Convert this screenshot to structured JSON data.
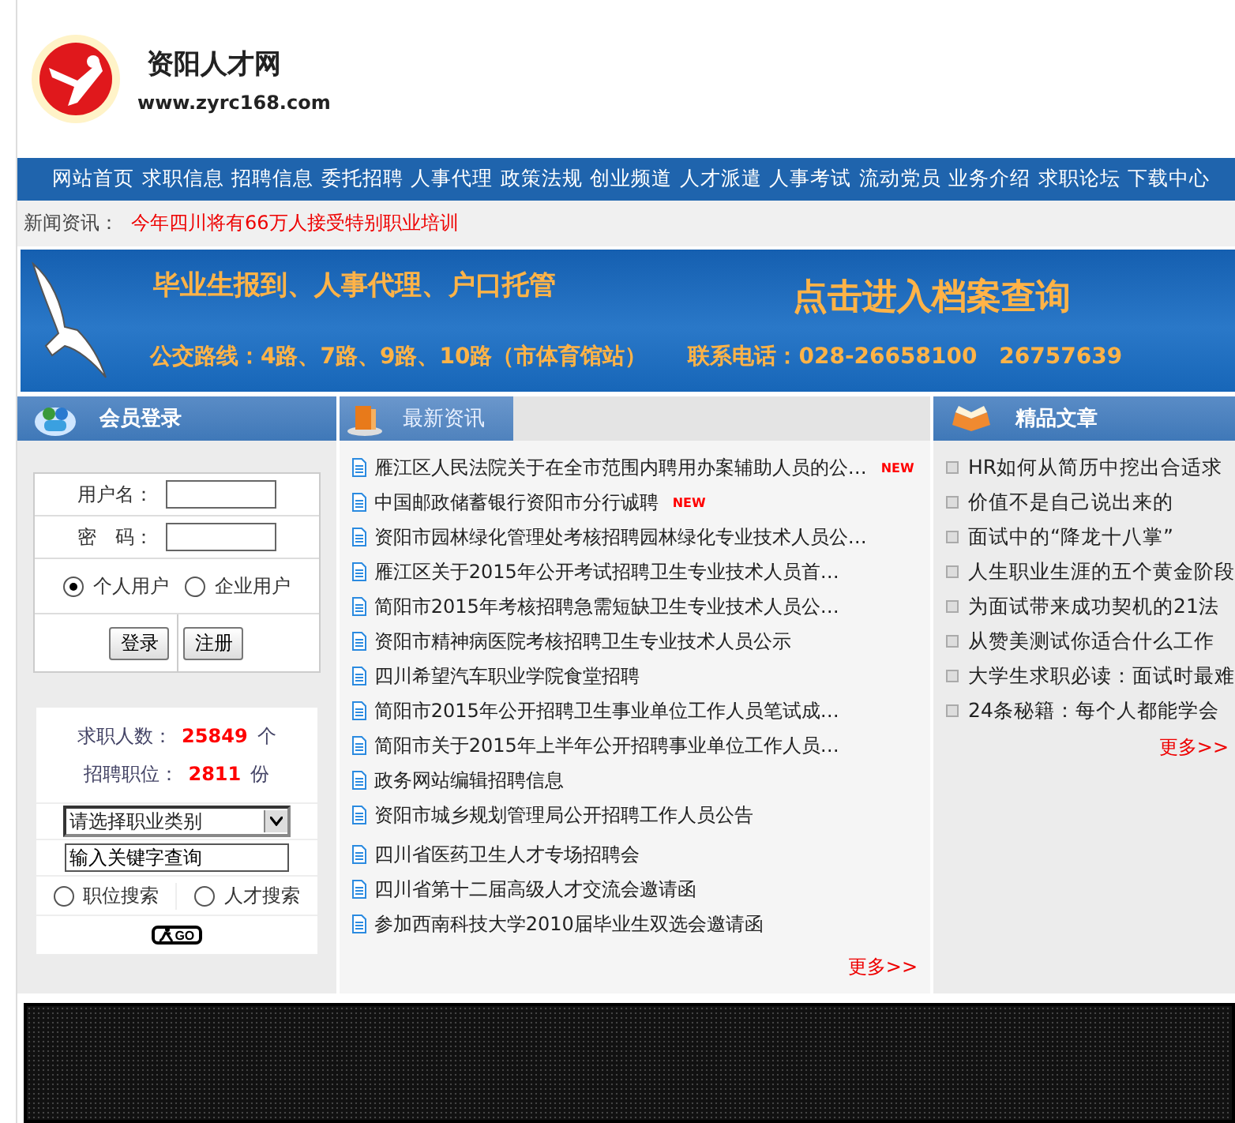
{
  "header": {
    "site_name": "资阳人才网",
    "url": "www.zyrc168.com"
  },
  "nav": [
    "网站首页",
    "求职信息",
    "招聘信息",
    "委托招聘",
    "人事代理",
    "政策法规",
    "创业频道",
    "人才派遣",
    "人事考试",
    "流动党员",
    "业务介绍",
    "求职论坛",
    "下载中心"
  ],
  "ticker": {
    "label": "新闻资讯：",
    "headline": "今年四川将有66万人接受特别职业培训"
  },
  "banner": {
    "headline": "毕业生报到、人事代理、户口托管",
    "link": "点击进入档案查询",
    "bus": "公交路线：4路、7路、9路、10路（市体育馆站）",
    "phone": "联系电话：028-26658100　26757639"
  },
  "login": {
    "title": "会员登录",
    "username_label": "用户名：",
    "password_label": "密　码：",
    "user_types": [
      {
        "label": "个人用户",
        "selected": true
      },
      {
        "label": "企业用户",
        "selected": false
      }
    ],
    "buttons": [
      "登录",
      "注册"
    ]
  },
  "stats": [
    {
      "label": "求职人数：",
      "value": "25849",
      "unit": "个"
    },
    {
      "label": "招聘职位：",
      "value": "2811",
      "unit": "份"
    }
  ],
  "search": {
    "category": "请选择职业类别",
    "keyword": "输入关键字查询",
    "modes": [
      {
        "label": "职位搜索",
        "selected": false
      },
      {
        "label": "人才搜索",
        "selected": false
      }
    ],
    "go": "GO"
  },
  "news": {
    "title": "最新资讯",
    "items": [
      {
        "text": "雁江区人民法院关于在全市范围内聘用办案辅助人员的公…",
        "badge": "NEW"
      },
      {
        "text": "中国邮政储蓄银行资阳市分行诚聘",
        "badge": "NEW"
      },
      {
        "text": "资阳市园林绿化管理处考核招聘园林绿化专业技术人员公…"
      },
      {
        "text": "雁江区关于2015年公开考试招聘卫生专业技术人员首…"
      },
      {
        "text": "简阳市2015年考核招聘急需短缺卫生专业技术人员公…"
      },
      {
        "text": "资阳市精神病医院考核招聘卫生专业技术人员公示"
      },
      {
        "text": "四川希望汽车职业学院食堂招聘"
      },
      {
        "text": "简阳市2015年公开招聘卫生事业单位工作人员笔试成…"
      },
      {
        "text": "简阳市关于2015年上半年公开招聘事业单位工作人员…"
      },
      {
        "text": "政务网站编辑招聘信息"
      },
      {
        "text": "资阳市城乡规划管理局公开招聘工作人员公告"
      },
      {
        "text": "四川省医药卫生人才专场招聘会"
      },
      {
        "text": "四川省第十二届高级人才交流会邀请函"
      },
      {
        "text": "参加西南科技大学2010届毕业生双选会邀请函"
      }
    ],
    "more": "更多>>"
  },
  "articles": {
    "title": "精品文章",
    "items": [
      "HR如何从简历中挖出合适求",
      "价值不是自己说出来的",
      "面试中的“降龙十八掌”",
      "人生职业生涯的五个黄金阶段",
      "为面试带来成功契机的21法",
      "从赞美测试你适合什么工作",
      "大学生求职必读：面试时最难",
      "24条秘籍：每个人都能学会"
    ],
    "more": "更多>>"
  }
}
